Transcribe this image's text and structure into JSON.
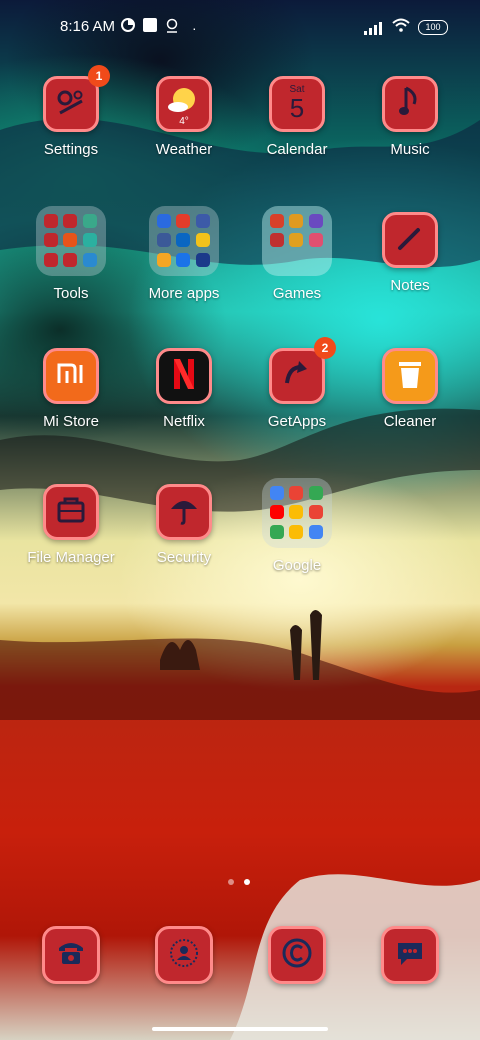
{
  "status_bar": {
    "time": "8:16 AM",
    "battery": "100"
  },
  "apps": [
    {
      "label": "Settings",
      "badge": "1"
    },
    {
      "label": "Weather",
      "temp": "4°"
    },
    {
      "label": "Calendar",
      "day": "Sat",
      "date": "5"
    },
    {
      "label": "Music"
    },
    {
      "label": "Tools"
    },
    {
      "label": "More apps"
    },
    {
      "label": "Games"
    },
    {
      "label": "Notes"
    },
    {
      "label": "Mi Store"
    },
    {
      "label": "Netflix"
    },
    {
      "label": "GetApps",
      "badge": "2"
    },
    {
      "label": "Cleaner"
    },
    {
      "label": "File Manager"
    },
    {
      "label": "Security"
    },
    {
      "label": "Google"
    }
  ],
  "dock": [
    {
      "icon": "phone-icon"
    },
    {
      "icon": "contacts-icon"
    },
    {
      "icon": "copyright-icon"
    },
    {
      "icon": "messages-icon"
    }
  ],
  "colors": {
    "tile": "#c0272d",
    "tile_border": "#ff8a8a",
    "badge": "#f04a1a"
  },
  "pages": {
    "count": 2,
    "current": 2
  }
}
